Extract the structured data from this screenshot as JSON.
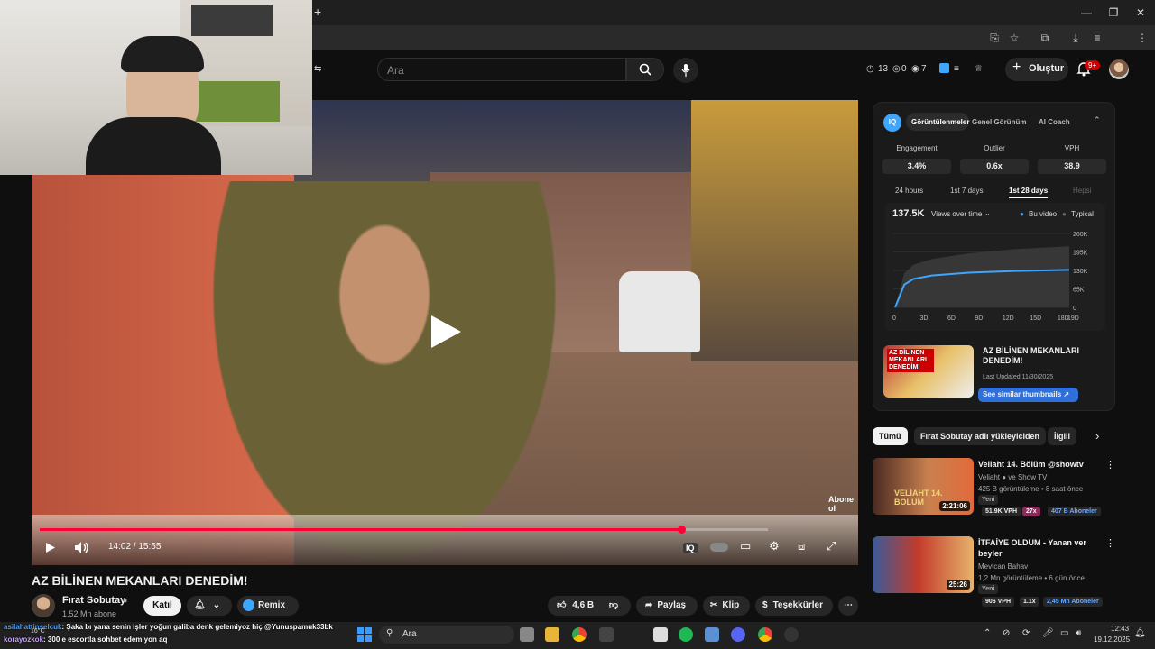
{
  "browser": {
    "new_tab_glyph": "+",
    "win_minimize": "—",
    "win_maximize": "❐",
    "win_close": "✕"
  },
  "header": {
    "search_placeholder": "Ara",
    "stats": {
      "clock": "13",
      "zero": "0",
      "views": "7"
    },
    "create_label": "Oluştur",
    "notif_badge": "9+"
  },
  "player": {
    "time": "14:02 / 15:55",
    "progress": 0.881,
    "watermark": "Abone ol"
  },
  "video": {
    "title": "AZ BİLİNEN MEKANLARI DENEDİM!",
    "channel": "Fırat Sobutay",
    "subs": "1,52 Mn abone",
    "join": "Katıl",
    "remix": "Remix",
    "likes": "4,6 B",
    "share": "Paylaş",
    "clip": "Klip",
    "thanks": "Teşekkürler"
  },
  "iq": {
    "logo": "IQ",
    "tabs": [
      "Görüntülenmeler",
      "Genel Görünüm",
      "AI Coach"
    ],
    "metrics": [
      {
        "label": "Engagement",
        "value": "3.4%"
      },
      {
        "label": "Outlier",
        "value": "0.6x"
      },
      {
        "label": "VPH",
        "value": "38.9"
      }
    ],
    "ranges": [
      "24 hours",
      "1st 7 days",
      "1st 28 days",
      "Hepsi"
    ],
    "total_views": "137.5K",
    "views_dropdown": "Views over time",
    "legend_this": "Bu video",
    "legend_typical": "Typical",
    "thumb_title": "AZ BİLİNEN MEKANLARI DENEDİM!",
    "last_updated": "Last Updated 11/30/2025",
    "similar_btn": "See similar thumbnails"
  },
  "chart_data": {
    "type": "area",
    "title": "",
    "x": [
      "0",
      "3D",
      "6D",
      "9D",
      "12D",
      "15D",
      "18D",
      "19D"
    ],
    "y_ticks": [
      "260K",
      "195K",
      "130K",
      "65K",
      "0"
    ],
    "ylim": [
      0,
      260000
    ],
    "series": [
      {
        "name": "Bu video",
        "points": [
          [
            0,
            0
          ],
          [
            1,
            80000
          ],
          [
            2,
            100000
          ],
          [
            4,
            112000
          ],
          [
            8,
            122000
          ],
          [
            13,
            128000
          ],
          [
            19,
            132000
          ]
        ]
      },
      {
        "name": "Typical",
        "points": [
          [
            0,
            0
          ],
          [
            1,
            120000
          ],
          [
            2,
            150000
          ],
          [
            4,
            170000
          ],
          [
            8,
            190000
          ],
          [
            13,
            205000
          ],
          [
            19,
            215000
          ]
        ]
      }
    ]
  },
  "chips": [
    "Tümü",
    "Fırat Sobutay adlı yükleyiciden",
    "İlgili"
  ],
  "recommendations": [
    {
      "title": "Veliaht 14. Bölüm @showtv",
      "channel": "Veliaht ● ve Show TV",
      "meta": "425 B görüntüleme • 8 saat önce",
      "new": "Yeni",
      "vph": "51.9K VPH",
      "mult": "27x",
      "subs": "407 B Aboneler",
      "duration": "2:21:06",
      "thumb_text": "VELİAHT 14. BÖLÜM"
    },
    {
      "title": "İTFAİYE OLDUM - Yanan ver beyler",
      "channel": "Mevtcan Bahav",
      "meta": "1,2 Mn görüntüleme • 6 gün önce",
      "new": "Yeni",
      "vph": "906 VPH",
      "mult": "1.1x",
      "subs": "2,45 Mn Aboneler",
      "duration": "25:26",
      "thumb_text": ""
    }
  ],
  "chat": [
    {
      "user": "asilahattinselcuk",
      "text": ": Şaka bı yana senin işler yoğun galiba denk gelemiyoz hiç @Yunuspamuk33bk"
    },
    {
      "user": "korayozkok",
      "text": ": 300 e escortla sohbet edemiyon aq"
    }
  ],
  "taskbar": {
    "search": "Ara",
    "time": "12:43",
    "date": "19.12.2025",
    "temp": "16°C"
  },
  "colors": {
    "accent_red": "#ff0033",
    "iq_blue": "#3ea6ff"
  }
}
